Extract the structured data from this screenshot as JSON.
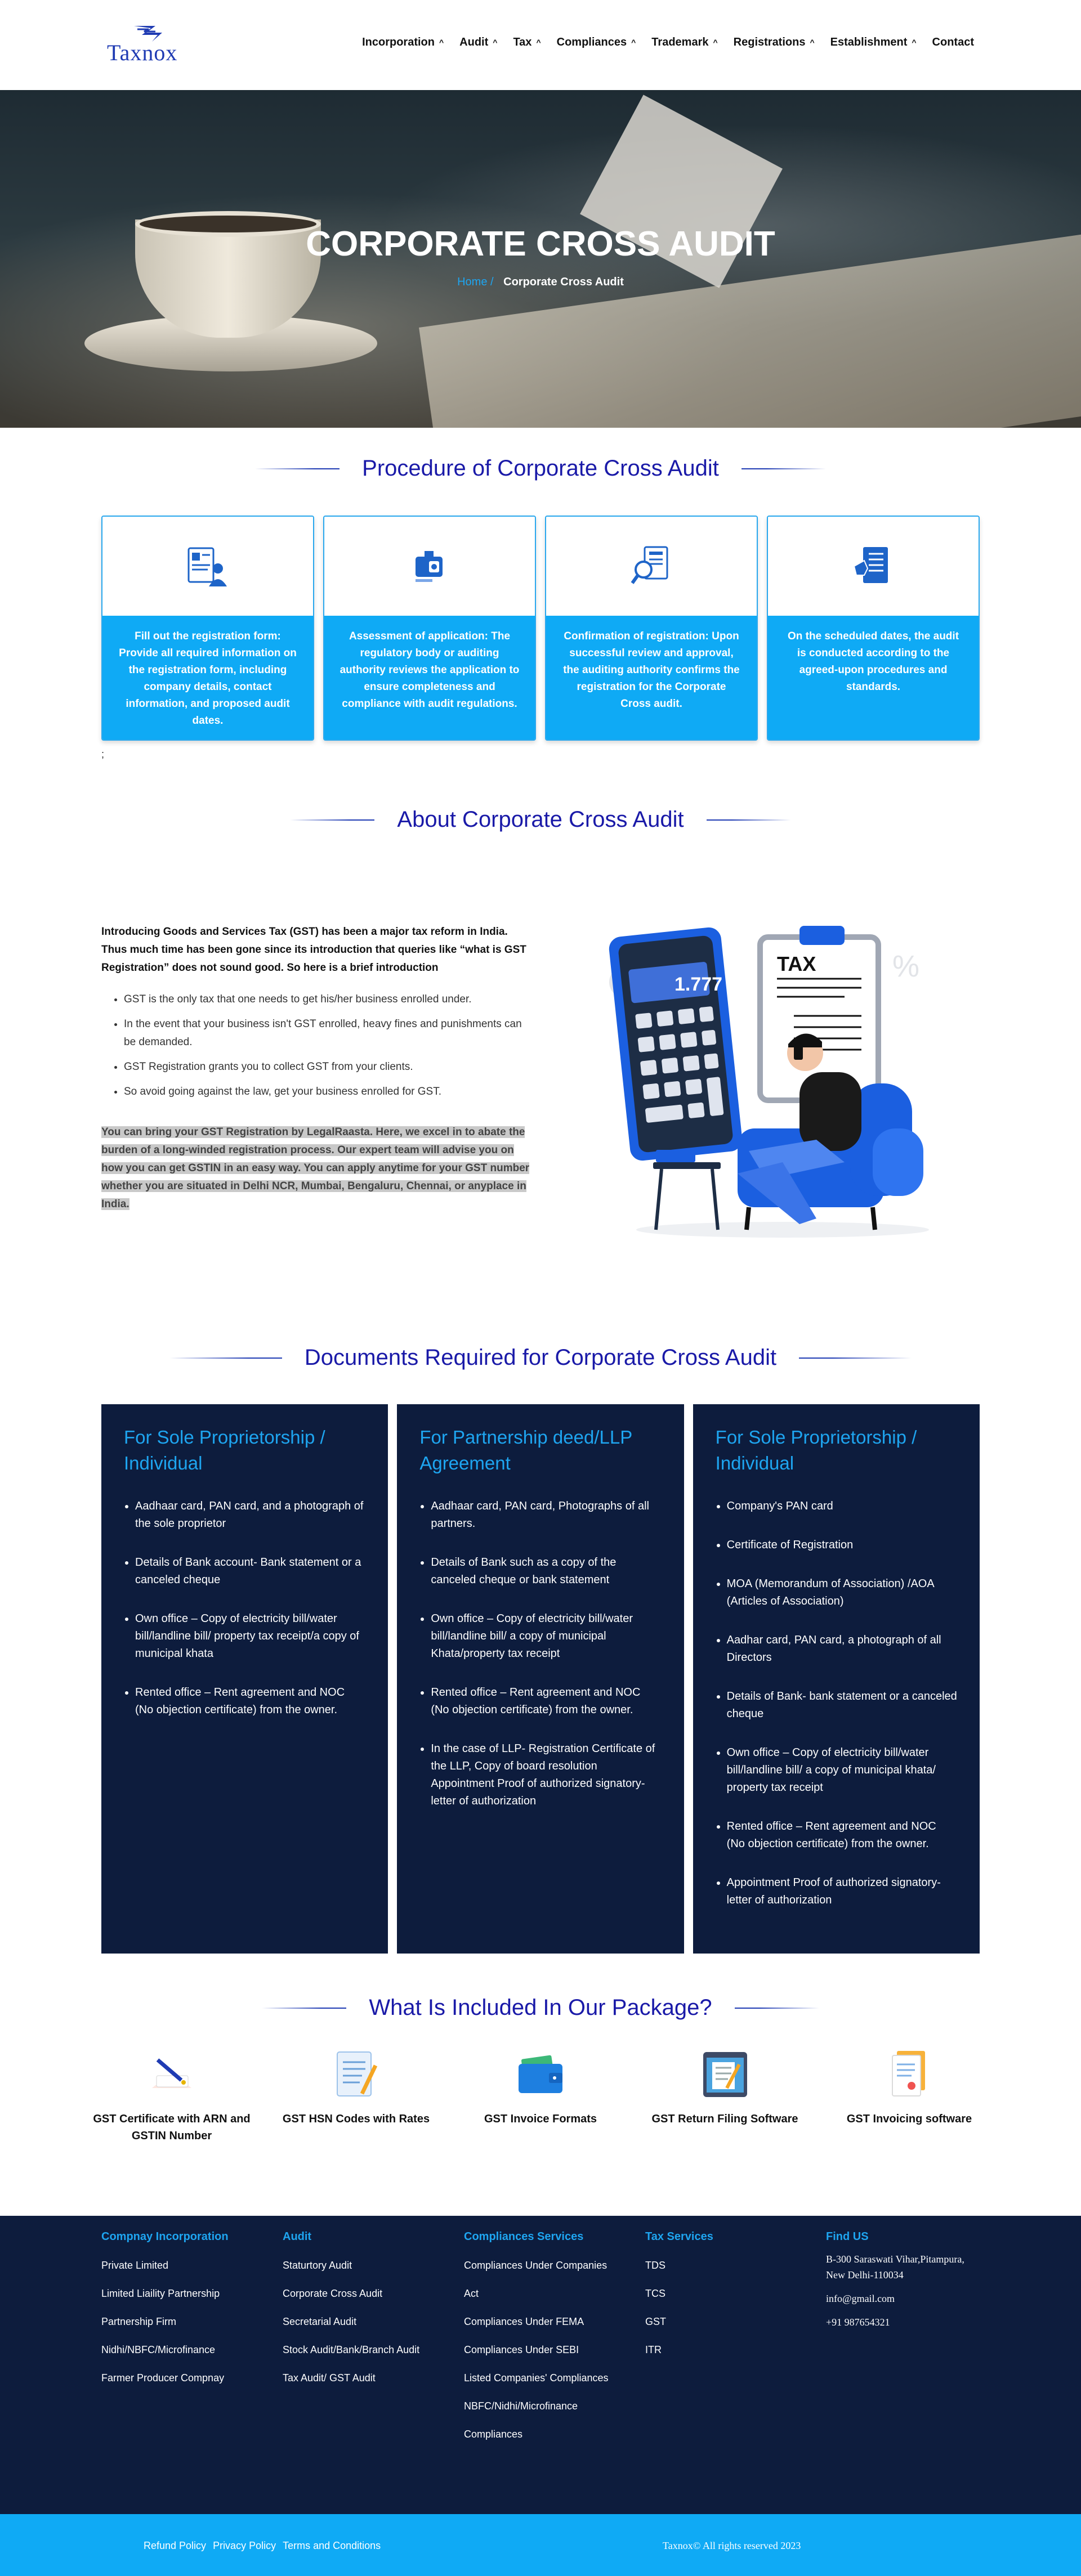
{
  "header": {
    "logo_text": "Taxnox",
    "nav": [
      {
        "label": "Incorporation",
        "dropdown": true
      },
      {
        "label": "Audit",
        "dropdown": true
      },
      {
        "label": "Tax",
        "dropdown": true
      },
      {
        "label": "Compliances",
        "dropdown": true
      },
      {
        "label": "Trademark",
        "dropdown": true
      },
      {
        "label": "Registrations",
        "dropdown": true
      },
      {
        "label": "Establishment",
        "dropdown": true
      },
      {
        "label": "Contact",
        "dropdown": false
      }
    ]
  },
  "hero": {
    "title": "CORPORATE CROSS AUDIT",
    "breadcrumb_home": "Home /",
    "breadcrumb_current": "Corporate Cross Audit"
  },
  "procedure": {
    "title": "Procedure of Corporate Cross Audit",
    "steps": [
      {
        "icon": "registration-form-icon",
        "text": "Fill out the registration form: Provide all required information on the registration form, including company details, contact information, and proposed audit dates."
      },
      {
        "icon": "id-card-icon",
        "text": "Assessment of application: The regulatory body or auditing authority reviews the application to ensure completeness and compliance with audit regulations."
      },
      {
        "icon": "document-search-icon",
        "text": "Confirmation of registration: Upon successful review and approval, the auditing authority confirms the registration for the Corporate Cross audit."
      },
      {
        "icon": "document-hand-icon",
        "text": "On the scheduled dates, the audit is conducted according to the agreed-upon procedures and standards."
      }
    ],
    "trailing": ";"
  },
  "about": {
    "title": "About Corporate Cross Audit",
    "intro": "Introducing Goods and Services Tax (GST) has been a major tax reform in India. Thus much time has been gone since its introduction that queries like “what is GST Registration” does not sound good. So here is a brief introduction",
    "bullets": [
      "GST is the only tax that one needs to get his/her business enrolled under.",
      "In the event that your business isn't GST enrolled, heavy fines and punishments can be demanded.",
      "GST Registration grants you to collect GST from your clients.",
      "So avoid going against the law, get your business enrolled for GST."
    ],
    "highlight": "You can bring your GST Registration by LegalRaasta. Here, we excel in to abate the burden of a long-winded registration process. Our expert team will advise you on how you can get GSTIN in an easy way. You can apply anytime for your GST number whether you are situated in Delhi NCR, Mumbai, Bengaluru, Chennai, or anyplace in India.",
    "illustration": {
      "calc_display": "1.777",
      "tax_label": "TAX",
      "percent": "%"
    }
  },
  "documents": {
    "title": "Documents Required for Corporate Cross Audit",
    "columns": [
      {
        "heading": "For Sole Proprietorship / Individual",
        "items": [
          "Aadhaar card, PAN card, and a photograph of the sole proprietor",
          "Details of Bank account- Bank statement or a canceled cheque",
          "Own office – Copy of electricity bill/water bill/landline bill/ property tax receipt/a copy of municipal khata",
          "Rented office – Rent agreement and NOC (No objection certificate) from the owner."
        ]
      },
      {
        "heading": "For Partnership deed/LLP Agreement",
        "items": [
          "Aadhaar card, PAN card, Photographs of all partners.",
          "Details of Bank such as a copy of the canceled cheque or bank statement",
          "Own office – Copy of electricity bill/water bill/landline bill/ a copy of municipal Khata/property tax receipt",
          "Rented office – Rent agreement and NOC (No objection certificate) from the owner.",
          "In the case of LLP- Registration Certificate of the LLP, Copy of board resolution Appointment Proof of authorized signatory-letter of authorization"
        ]
      },
      {
        "heading": "For Sole Proprietorship / Individual",
        "items": [
          "Company's PAN card",
          "Certificate of Registration",
          "MOA (Memorandum of Association) /AOA (Articles of Association)",
          "Aadhar card, PAN card, a photograph of all Directors",
          "Details of Bank- bank statement or a canceled cheque",
          "Own office – Copy of electricity bill/water bill/landline bill/ a copy of municipal khata/ property tax receipt",
          "Rented office – Rent agreement and NOC (No objection certificate) from the owner.",
          "Appointment Proof of authorized signatory-letter of authorization"
        ]
      }
    ]
  },
  "package": {
    "title": "What Is Included In Our Package?",
    "items": [
      {
        "icon": "certificate-pen-icon",
        "label": "GST Certificate with ARN and GSTIN Number"
      },
      {
        "icon": "document-pencil-icon",
        "label": "GST HSN Codes with Rates"
      },
      {
        "icon": "wallet-icon",
        "label": "GST Invoice Formats"
      },
      {
        "icon": "monitor-document-icon",
        "label": "GST Return Filing Software"
      },
      {
        "icon": "invoice-icon",
        "label": "GST Invoicing software"
      }
    ]
  },
  "footer": {
    "columns": [
      {
        "heading": "Compnay Incorporation",
        "links": [
          "Private Limited",
          "Limited Liaility Partnership",
          "Partnership Firm",
          "Nidhi/NBFC/Microfinance",
          "Farmer Producer Compnay"
        ]
      },
      {
        "heading": "Audit",
        "links": [
          "Staturtory Audit",
          "Corporate Cross Audit",
          "Secretarial Audit",
          "Stock Audit/Bank/Branch Audit",
          "Tax Audit/ GST Audit"
        ]
      },
      {
        "heading": "Compliances Services",
        "links": [
          "Compliances Under Companies",
          "Act",
          "Compliances Under FEMA",
          "Compliances Under SEBI",
          "Listed Companies' Compliances",
          "NBFC/Nidhi/Microfinance",
          "Compliances"
        ]
      },
      {
        "heading": "Tax Services",
        "links": [
          "TDS",
          "TCS",
          "GST",
          "ITR"
        ]
      }
    ],
    "contact": {
      "heading": "Find US",
      "address": "B-300 Saraswati Vihar,Pitampura, New Delhi-110034",
      "email": "info@gmail.com",
      "phone": "+91 987654321"
    },
    "bottom_links": [
      "Refund Policy",
      "Privacy Policy",
      "Terms and Conditions"
    ],
    "copyright": "Taxnox© All rights reserved 2023"
  },
  "colors": {
    "brand_blue": "#1a1aa8",
    "accent": "#0faaf5",
    "navy": "#0d1c3d"
  }
}
